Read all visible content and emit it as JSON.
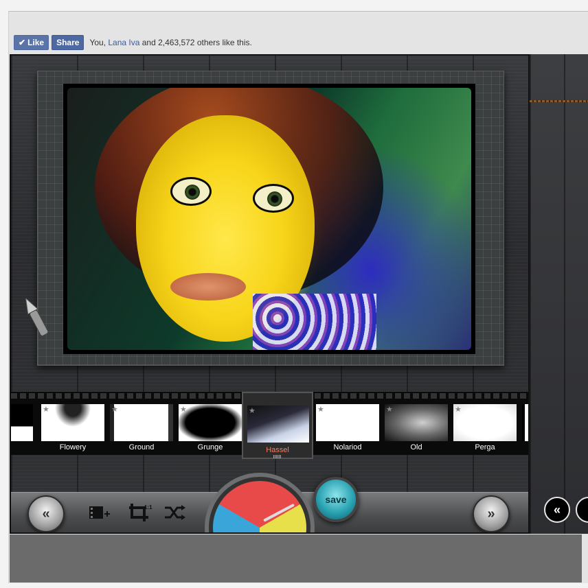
{
  "social": {
    "like_label": "Like",
    "share_label": "Share",
    "likes_prefix": "You, ",
    "likes_name": "Lana Iva",
    "likes_suffix": " and 2,463,572 others like this."
  },
  "filters": [
    {
      "label": ""
    },
    {
      "label": "Flowery"
    },
    {
      "label": "Ground"
    },
    {
      "label": "Grunge"
    },
    {
      "label": "Hassel",
      "selected": true
    },
    {
      "label": "Nolariod"
    },
    {
      "label": "Old"
    },
    {
      "label": "Perga"
    },
    {
      "label": ""
    }
  ],
  "toolbar": {
    "save_label": "save",
    "prev_icon": "double-chevron-left-icon",
    "next_icon": "double-chevron-right-icon",
    "film_icon": "film-add-icon",
    "crop_icon": "crop-icon",
    "shuffle_icon": "shuffle-icon"
  },
  "colors": {
    "accent_selected": "#ff7a5a",
    "save_button": "#2aa3b3",
    "facebook_blue": "#4e69a2"
  }
}
